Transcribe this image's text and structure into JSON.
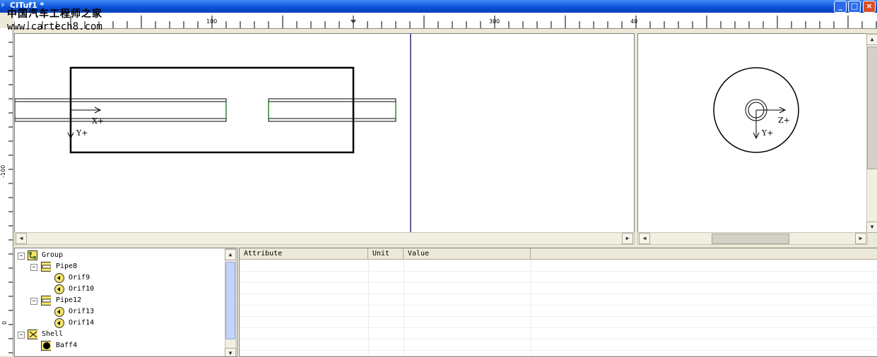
{
  "window": {
    "title": "CITuf1 *",
    "minimize_glyph": "_",
    "maximize_glyph": "□",
    "close_glyph": "×"
  },
  "watermark": {
    "line1": "中国汽车工程师之家",
    "line2": "www.cartech8.com"
  },
  "rulers": {
    "horizontal_labels": [
      "100",
      "300",
      "40"
    ],
    "vertical_labels": [
      "-100",
      "0"
    ]
  },
  "side_view": {
    "x_axis_label": "X+",
    "y_axis_label": "Y+"
  },
  "end_view": {
    "z_axis_label": "Z+",
    "y_axis_label": "Y+"
  },
  "tree": {
    "items": [
      {
        "label": "Group",
        "icon": "group-icon",
        "expander": "−"
      },
      {
        "label": "Pipe8",
        "icon": "pipe-icon",
        "expander": "−"
      },
      {
        "label": "Orif9",
        "icon": "orifice-icon"
      },
      {
        "label": "Orif10",
        "icon": "orifice-icon"
      },
      {
        "label": "Pipe12",
        "icon": "pipe-icon",
        "expander": "−"
      },
      {
        "label": "Orif13",
        "icon": "orifice-icon"
      },
      {
        "label": "Orif14",
        "icon": "orifice-icon"
      },
      {
        "label": "Shell",
        "icon": "shell-icon",
        "expander": "−"
      },
      {
        "label": "Baff4",
        "icon": "baffle-icon"
      }
    ]
  },
  "grid": {
    "columns": [
      "Attribute",
      "Unit",
      "Value"
    ]
  },
  "colors": {
    "titlebar": "#0a4fd6",
    "pipe_end": "#2e8b2e",
    "splitter": "#2a2a7a"
  }
}
